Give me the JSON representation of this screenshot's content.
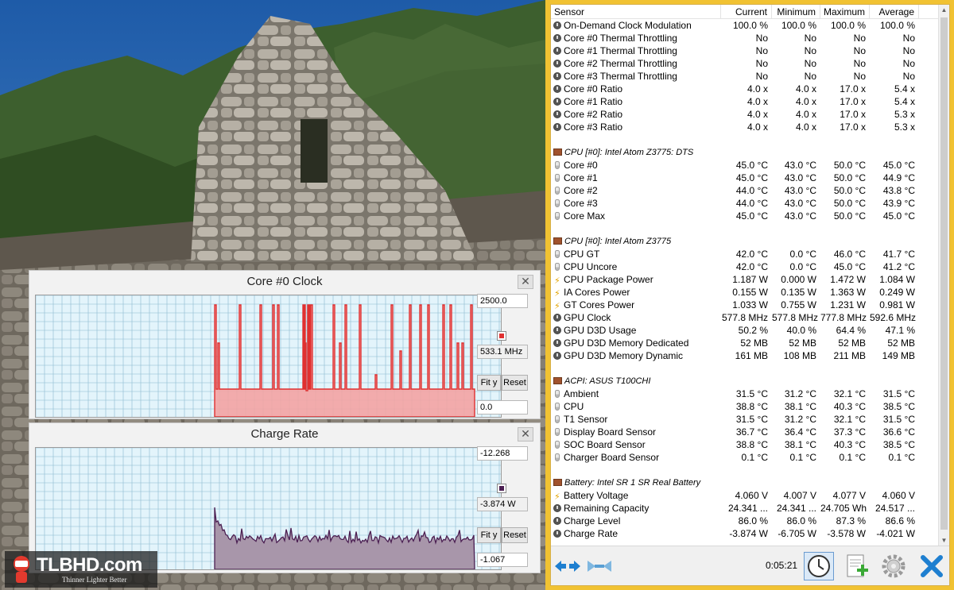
{
  "sensor_table": {
    "columns": [
      "Sensor",
      "Current",
      "Minimum",
      "Maximum",
      "Average"
    ],
    "rows": [
      {
        "icon": "clock",
        "name": "On-Demand Clock Modulation",
        "cur": "100.0 %",
        "min": "100.0 %",
        "max": "100.0 %",
        "avg": "100.0 %"
      },
      {
        "icon": "clock",
        "name": "Core #0 Thermal Throttling",
        "cur": "No",
        "min": "No",
        "max": "No",
        "avg": "No"
      },
      {
        "icon": "clock",
        "name": "Core #1 Thermal Throttling",
        "cur": "No",
        "min": "No",
        "max": "No",
        "avg": "No"
      },
      {
        "icon": "clock",
        "name": "Core #2 Thermal Throttling",
        "cur": "No",
        "min": "No",
        "max": "No",
        "avg": "No"
      },
      {
        "icon": "clock",
        "name": "Core #3 Thermal Throttling",
        "cur": "No",
        "min": "No",
        "max": "No",
        "avg": "No"
      },
      {
        "icon": "clock",
        "name": "Core #0 Ratio",
        "cur": "4.0 x",
        "min": "4.0 x",
        "max": "17.0 x",
        "avg": "5.4 x"
      },
      {
        "icon": "clock",
        "name": "Core #1 Ratio",
        "cur": "4.0 x",
        "min": "4.0 x",
        "max": "17.0 x",
        "avg": "5.4 x"
      },
      {
        "icon": "clock",
        "name": "Core #2 Ratio",
        "cur": "4.0 x",
        "min": "4.0 x",
        "max": "17.0 x",
        "avg": "5.3 x"
      },
      {
        "icon": "clock",
        "name": "Core #3 Ratio",
        "cur": "4.0 x",
        "min": "4.0 x",
        "max": "17.0 x",
        "avg": "5.3 x"
      },
      {
        "blank": true
      },
      {
        "group": true,
        "icon": "chip",
        "name": "CPU [#0]: Intel Atom Z3775: DTS"
      },
      {
        "icon": "thermo",
        "name": "Core #0",
        "cur": "45.0 °C",
        "min": "43.0 °C",
        "max": "50.0 °C",
        "avg": "45.0 °C"
      },
      {
        "icon": "thermo",
        "name": "Core #1",
        "cur": "45.0 °C",
        "min": "43.0 °C",
        "max": "50.0 °C",
        "avg": "44.9 °C"
      },
      {
        "icon": "thermo",
        "name": "Core #2",
        "cur": "44.0 °C",
        "min": "43.0 °C",
        "max": "50.0 °C",
        "avg": "43.8 °C"
      },
      {
        "icon": "thermo",
        "name": "Core #3",
        "cur": "44.0 °C",
        "min": "43.0 °C",
        "max": "50.0 °C",
        "avg": "43.9 °C"
      },
      {
        "icon": "thermo",
        "name": "Core Max",
        "cur": "45.0 °C",
        "min": "43.0 °C",
        "max": "50.0 °C",
        "avg": "45.0 °C"
      },
      {
        "blank": true
      },
      {
        "group": true,
        "icon": "chip",
        "name": "CPU [#0]: Intel Atom Z3775"
      },
      {
        "icon": "thermo",
        "name": "CPU GT",
        "cur": "42.0 °C",
        "min": "0.0 °C",
        "max": "46.0 °C",
        "avg": "41.7 °C"
      },
      {
        "icon": "thermo",
        "name": "CPU Uncore",
        "cur": "42.0 °C",
        "min": "0.0 °C",
        "max": "45.0 °C",
        "avg": "41.2 °C"
      },
      {
        "icon": "bolt",
        "name": "CPU Package Power",
        "cur": "1.187 W",
        "min": "0.000 W",
        "max": "1.472 W",
        "avg": "1.084 W"
      },
      {
        "icon": "bolt",
        "name": "IA Cores Power",
        "cur": "0.155 W",
        "min": "0.135 W",
        "max": "1.363 W",
        "avg": "0.249 W"
      },
      {
        "icon": "bolt",
        "name": "GT Cores Power",
        "cur": "1.033 W",
        "min": "0.755 W",
        "max": "1.231 W",
        "avg": "0.981 W"
      },
      {
        "icon": "clock",
        "name": "GPU Clock",
        "cur": "577.8 MHz",
        "min": "577.8 MHz",
        "max": "777.8 MHz",
        "avg": "592.6 MHz"
      },
      {
        "icon": "clock",
        "name": "GPU D3D Usage",
        "cur": "50.2 %",
        "min": "40.0 %",
        "max": "64.4 %",
        "avg": "47.1 %"
      },
      {
        "icon": "clock",
        "name": "GPU D3D Memory Dedicated",
        "cur": "52 MB",
        "min": "52 MB",
        "max": "52 MB",
        "avg": "52 MB"
      },
      {
        "icon": "clock",
        "name": "GPU D3D Memory Dynamic",
        "cur": "161 MB",
        "min": "108 MB",
        "max": "211 MB",
        "avg": "149 MB"
      },
      {
        "blank": true
      },
      {
        "group": true,
        "icon": "chip",
        "name": "ACPI: ASUS T100CHI"
      },
      {
        "icon": "thermo",
        "name": "Ambient",
        "cur": "31.5 °C",
        "min": "31.2 °C",
        "max": "32.1 °C",
        "avg": "31.5 °C"
      },
      {
        "icon": "thermo",
        "name": "CPU",
        "cur": "38.8 °C",
        "min": "38.1 °C",
        "max": "40.3 °C",
        "avg": "38.5 °C"
      },
      {
        "icon": "thermo",
        "name": "T1 Sensor",
        "cur": "31.5 °C",
        "min": "31.2 °C",
        "max": "32.1 °C",
        "avg": "31.5 °C"
      },
      {
        "icon": "thermo",
        "name": "Display Board Sensor",
        "cur": "36.7 °C",
        "min": "36.4 °C",
        "max": "37.3 °C",
        "avg": "36.6 °C"
      },
      {
        "icon": "thermo",
        "name": "SOC Board Sensor",
        "cur": "38.8 °C",
        "min": "38.1 °C",
        "max": "40.3 °C",
        "avg": "38.5 °C"
      },
      {
        "icon": "thermo",
        "name": "Charger Board Sensor",
        "cur": "0.1 °C",
        "min": "0.1 °C",
        "max": "0.1 °C",
        "avg": "0.1 °C"
      },
      {
        "blank": true
      },
      {
        "group": true,
        "icon": "chip",
        "name": "Battery: Intel SR 1 SR Real Battery"
      },
      {
        "icon": "bolt",
        "name": "Battery Voltage",
        "cur": "4.060 V",
        "min": "4.007 V",
        "max": "4.077 V",
        "avg": "4.060 V"
      },
      {
        "icon": "clock",
        "name": "Remaining Capacity",
        "cur": "24.341 ...",
        "min": "24.341 ...",
        "max": "24.705 Wh",
        "avg": "24.517 ..."
      },
      {
        "icon": "clock",
        "name": "Charge Level",
        "cur": "86.0 %",
        "min": "86.0 %",
        "max": "87.3 %",
        "avg": "86.6 %"
      },
      {
        "icon": "clock",
        "name": "Charge Rate",
        "cur": "-3.874 W",
        "min": "-6.705 W",
        "max": "-3.578 W",
        "avg": "-4.021 W"
      }
    ]
  },
  "footer": {
    "elapsed": "0:05:21",
    "buttons": [
      "expand-collapse",
      "layout",
      "clock",
      "report",
      "settings",
      "close"
    ]
  },
  "graphs": [
    {
      "title": "Core #0 Clock",
      "max_value": "2500.0",
      "current_value": "533.1 MHz",
      "min_value": "0.0",
      "fit_label": "Fit y",
      "reset_label": "Reset",
      "line_color": "#e03030",
      "fill_color": "#f3a3a3"
    },
    {
      "title": "Charge Rate",
      "max_value": "-12.268",
      "current_value": "-3.874 W",
      "min_value": "-1.067",
      "fit_label": "Fit y",
      "reset_label": "Reset",
      "line_color": "#4b1f52",
      "fill_color": "#a896aa"
    }
  ],
  "watermark": {
    "brand": "TLBHD.com",
    "tagline": "Thinner Lighter Better"
  },
  "colors": {
    "frame": "#f1c232",
    "plot_bg": "#e3f4fb",
    "grid": "#8ab8cf"
  }
}
